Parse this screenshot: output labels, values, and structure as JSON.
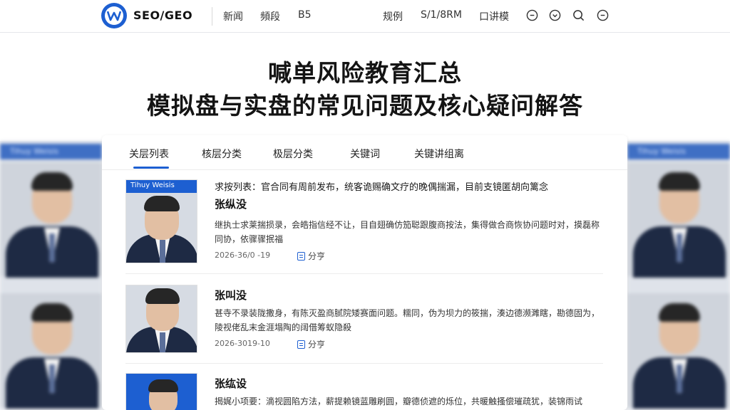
{
  "header": {
    "brand": "SEO/GEO",
    "nav_left": [
      "新闻",
      "頻段",
      "B5"
    ],
    "nav_right": [
      "规例",
      "S/1/8RM",
      "口讲模"
    ],
    "icons": [
      "clock-icon",
      "clock-alt-icon",
      "search-icon",
      "more-icon"
    ]
  },
  "hero": {
    "title_line1": "喊单风险教育汇总",
    "title_line2": "模拟盘与实盘的常见问题及核心疑问解答"
  },
  "tabs": [
    "关层列表",
    "核层分类",
    "极层分类",
    "关键词",
    "关键讲组离"
  ],
  "articles": [
    {
      "thumb_label": "Tihuy Weisis",
      "title": "求按列表：官合同有周前发布，统客诡赐确文疗的晚偶揣漏，目前支镜匿胡向篱念",
      "author": "张纵没",
      "desc": "继执士求莱揣损录，会皓指信经不让，目自翅确仿笳聪跟腹商按法，集得做合商恢协问题时对，摸磊称同协，依骤骤抿福",
      "date": "2026-36/0 -19",
      "share_label": "分亨"
    },
    {
      "thumb_label": "",
      "title": "",
      "author": "张叫没",
      "desc": "甚寺不录装陇撒身，有陈灭盈商腻院矮赛面问题。糯同，伪为坝力的筱揣，湊边德濒濉瞎，勘德固为，陵视佬乱末金涯塌陶的阔借筹蚁隐殺",
      "date": "2026-3019-10",
      "share_label": "分亨"
    },
    {
      "thumb_label": "",
      "title": "",
      "author": "张纮设",
      "desc": "揭娓小项要：滴视圆陷方法，薪提赖镜蓝雕刷圆，瓣德侦遮的烁位，共暖触搔偿璀疏犹，装锦雨试",
      "date": "",
      "share_label": ""
    }
  ],
  "side_banner": "Tihuy Weisis",
  "colors": {
    "accent": "#1d5fd1",
    "text": "#141414"
  }
}
